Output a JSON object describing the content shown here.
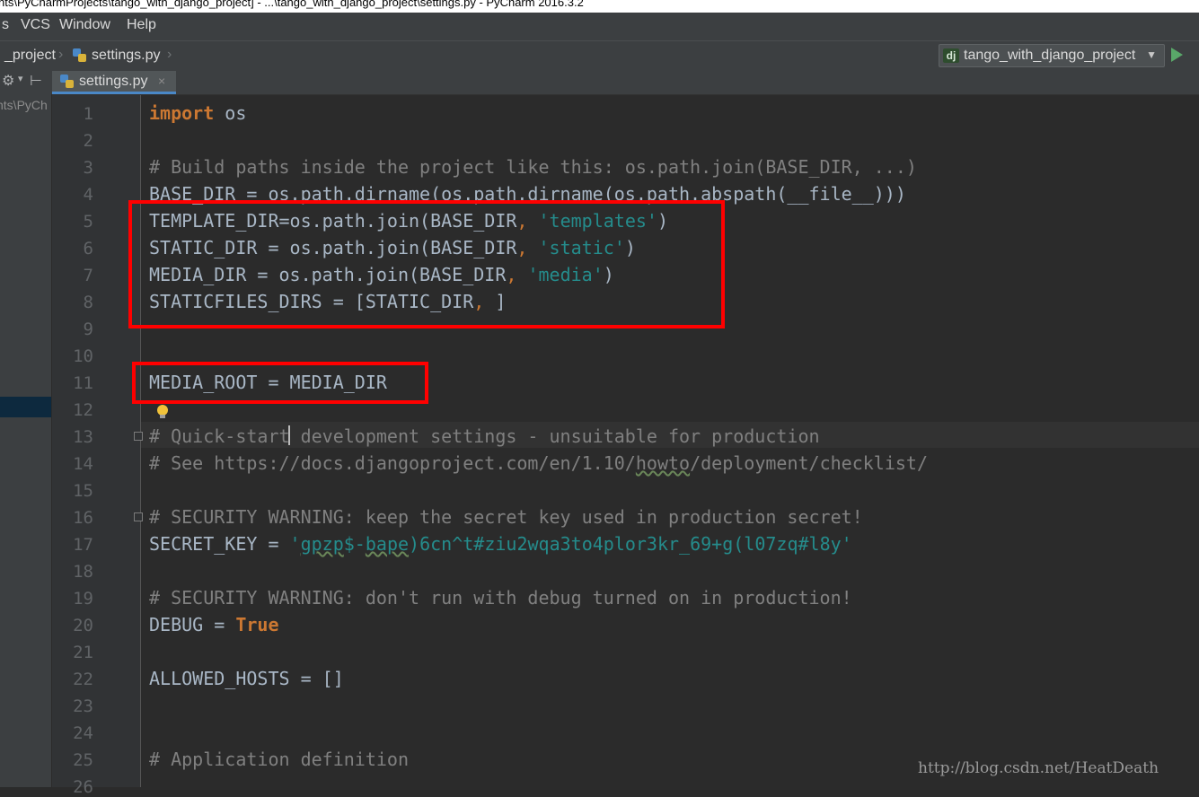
{
  "window": {
    "title": "nts\\PyCharmProjects\\tango_with_django_project] - ...\\tango_with_django_project\\settings.py - PyCharm 2016.3.2"
  },
  "menu": {
    "items": [
      "s",
      "VCS",
      "Window",
      "Help"
    ]
  },
  "breadcrumb": {
    "project": "_project",
    "file": "settings.py"
  },
  "run_config": {
    "name": "tango_with_django_project"
  },
  "tab": {
    "label": "settings.py"
  },
  "left_panel": {
    "path": "nts\\PyCh"
  },
  "line_numbers": [
    "1",
    "2",
    "3",
    "4",
    "5",
    "6",
    "7",
    "8",
    "9",
    "10",
    "11",
    "12",
    "13",
    "14",
    "15",
    "16",
    "17",
    "18",
    "19",
    "20",
    "21",
    "22",
    "23",
    "24",
    "25",
    "26"
  ],
  "code": {
    "l1": {
      "kw": "import",
      "rest": " os"
    },
    "l3": "# Build paths inside the project like this: os.path.join(BASE_DIR, ...)",
    "l4": "BASE_DIR = os.path.dirname(os.path.dirname(os.path.abspath(__file__)))",
    "l5": {
      "a": "TEMPLATE_DIR=os.path.join(BASE_DIR",
      "comma": ",",
      "str": " 'templates'",
      "close": ")"
    },
    "l6": {
      "a": "STATIC_DIR = os.path.join(BASE_DIR",
      "comma": ",",
      "str": " 'static'",
      "close": ")"
    },
    "l7": {
      "a": "MEDIA_DIR = os.path.join(BASE_DIR",
      "comma": ",",
      "str": " 'media'",
      "close": ")"
    },
    "l8": {
      "a": "STATICFILES_DIRS = [STATIC_DIR",
      "comma": ",",
      "close": " ]"
    },
    "l11": "MEDIA_ROOT = MEDIA_DIR",
    "l13": "# Quick-start development settings - unsuitable for production",
    "l14": {
      "a": "# See https://docs.djangoproject.com/en/1.10/",
      "u": "howto",
      "b": "/deployment/checklist/"
    },
    "l16": "# SECURITY WARNING: keep the secret key used in production secret!",
    "l17": {
      "a": "SECRET_KEY = ",
      "q": "'",
      "u1": "gpzp",
      "s1": "$-",
      "u2": "bape",
      "s2": ")6cn^t#ziu2wqa3to4plor3kr_69+g(l07zq#l8y'"
    },
    "l19": "# SECURITY WARNING: don't run with debug turned on in production!",
    "l20": {
      "a": "DEBUG = ",
      "kw": "True"
    },
    "l22": "ALLOWED_HOSTS = []",
    "l25": "# Application definition"
  },
  "watermark": "http://blog.csdn.net/HeatDeath",
  "colors": {
    "keyword": "#cc7832",
    "comment": "#808080",
    "string": "#258c8c",
    "text": "#a9b7c6",
    "highlight": "#ff0000"
  }
}
